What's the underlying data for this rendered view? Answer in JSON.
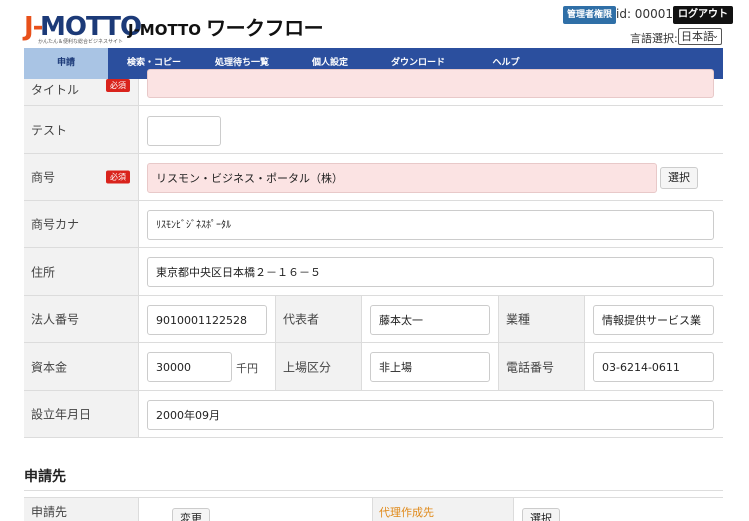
{
  "header": {
    "logo_j": "J-",
    "logo_m": "MOTTO",
    "logo_sub": "かんたん＆便利な総合ビジネスサイト",
    "title_en": "J-MOTTO",
    "title_ja": "ワークフロー",
    "admin_label": "管理者権限",
    "user_id": "id: 00001",
    "logout_label": "ログアウト",
    "lang_label": "言語選択:",
    "lang_value": "日本語"
  },
  "nav": {
    "items": [
      "申請",
      "検索・コピー",
      "処理待ち一覧",
      "個人設定",
      "ダウンロード",
      "ヘルプ"
    ],
    "active": "申請"
  },
  "form": {
    "required_badge": "必須",
    "title_label": "タイトル",
    "title_value": "",
    "test_label": "テスト",
    "test_value": "",
    "company_label": "商号",
    "company_value": "リスモン・ビジネス・ポータル（株）",
    "select_label": "選択",
    "kana_label": "商号カナ",
    "kana_value": "ﾘｽﾓﾝﾋﾞｼﾞﾈｽﾎﾟｰﾀﾙ",
    "address_label": "住所",
    "address_value": "東京都中央区日本橋２－１６－５",
    "corp_no_label": "法人番号",
    "corp_no_value": "9010001122528",
    "rep_label": "代表者",
    "rep_value": "藤本太一",
    "industry_label": "業種",
    "industry_value": "情報提供サービス業",
    "capital_label": "資本金",
    "capital_value": "30000",
    "capital_unit": "千円",
    "listing_label": "上場区分",
    "listing_value": "非上場",
    "phone_label": "電話番号",
    "phone_value": "03-6214-0611",
    "founded_label": "設立年月日",
    "founded_value": "2000年09月"
  },
  "applicant": {
    "section_title": "申請先",
    "row_label": "申請先",
    "change_label": "変更",
    "proxy_label": "代理作成先",
    "select_label": "選択"
  }
}
